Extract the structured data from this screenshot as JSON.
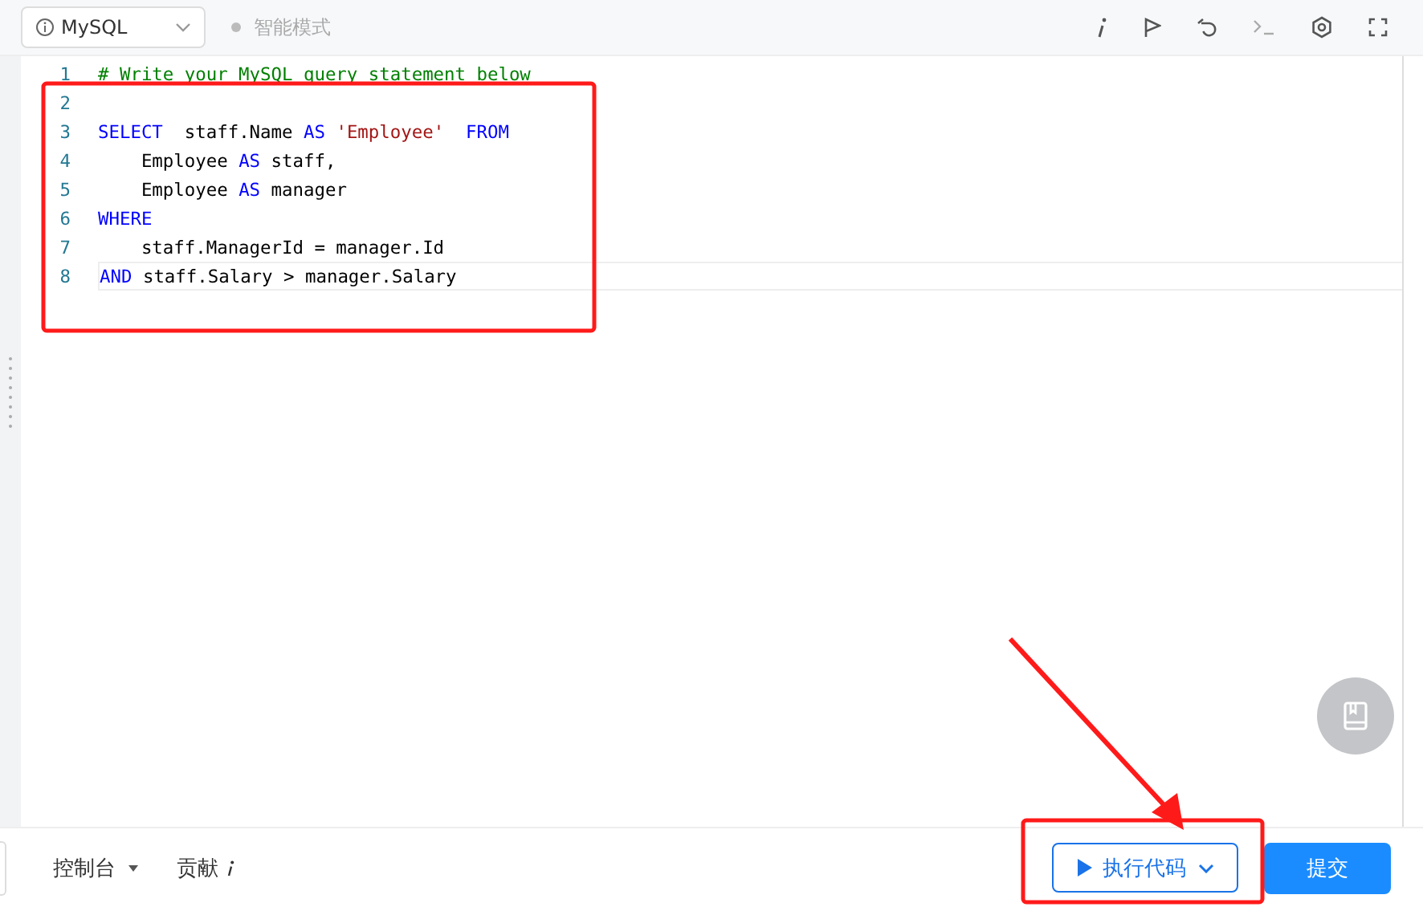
{
  "toolbar": {
    "language": "MySQL",
    "mode": "智能模式"
  },
  "editor": {
    "lines": [
      {
        "number": "1",
        "current": false,
        "tokens": [
          {
            "text": "# Write your MySQL query statement below",
            "kind": "comment"
          }
        ]
      },
      {
        "number": "2",
        "current": false
      },
      {
        "number": "3",
        "current": false,
        "tokens": [
          {
            "text": "SELECT",
            "kind": "keyword"
          },
          {
            "text": "  staff.Name ",
            "kind": "plain"
          },
          {
            "text": "AS",
            "kind": "keyword"
          },
          {
            "text": " 'Employee'  ",
            "kind": "string"
          },
          {
            "text": "FROM",
            "kind": "keyword"
          }
        ]
      },
      {
        "number": "4",
        "current": false,
        "tokens": [
          {
            "text": "    Employee ",
            "kind": "plain"
          },
          {
            "text": "AS",
            "kind": "keyword"
          },
          {
            "text": " staff,",
            "kind": "plain"
          }
        ]
      },
      {
        "number": "5",
        "current": false,
        "tokens": [
          {
            "text": "    Employee ",
            "kind": "plain"
          },
          {
            "text": "AS",
            "kind": "keyword"
          },
          {
            "text": " manager",
            "kind": "plain"
          }
        ]
      },
      {
        "number": "6",
        "current": false,
        "tokens": [
          {
            "text": "WHERE",
            "kind": "keyword"
          }
        ]
      },
      {
        "number": "7",
        "current": false,
        "tokens": [
          {
            "text": "    staff.ManagerId = manager.Id",
            "kind": "plain"
          }
        ]
      },
      {
        "number": "8",
        "current": true,
        "tokens": [
          {
            "text": "AND",
            "kind": "keyword"
          },
          {
            "text": " staff.Salary > manager.Salary",
            "kind": "plain"
          }
        ]
      }
    ]
  },
  "bottom_bar": {
    "console": "控制台",
    "contribute": "贡献",
    "run_button": "执行代码",
    "submit_button": "提交"
  }
}
